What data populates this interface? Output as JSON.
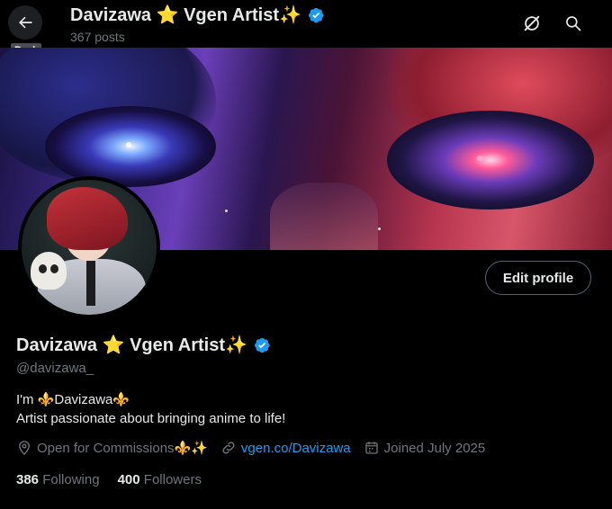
{
  "header": {
    "back_tooltip": "Back",
    "name": "Davizawa ⭐ Vgen Artist✨",
    "posts": "367 posts",
    "icons": [
      "back-arrow-icon",
      "grok-icon",
      "search-icon"
    ]
  },
  "profile": {
    "edit_label": "Edit profile",
    "name": "Davizawa ⭐ Vgen Artist✨",
    "handle": "@davizawa_",
    "bio_line1": "I'm  ⚜️Davizawa⚜️",
    "bio_line2": "Artist passionate about bringing anime to life!",
    "location": "Open for Commissions⚜️✨",
    "website": "vgen.co/Davizawa",
    "joined": "Joined July 2025",
    "following_count": "386",
    "following_label": "Following",
    "followers_count": "400",
    "followers_label": "Followers"
  },
  "colors": {
    "background": "#000000",
    "text_primary": "#e7e9ea",
    "text_secondary": "#71767b",
    "link": "#1d9bf0",
    "verified": "#1d9bf0",
    "border": "#536471"
  }
}
